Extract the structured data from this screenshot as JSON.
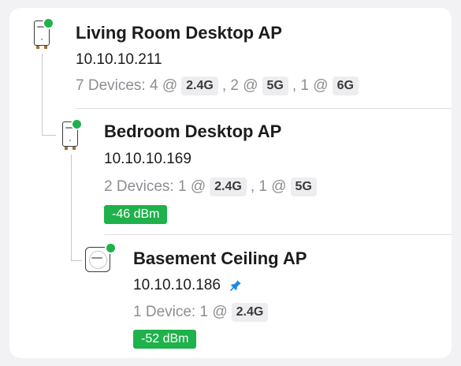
{
  "nodes": [
    {
      "title": "Living Room Desktop AP",
      "ip": "10.10.10.211",
      "devices_prefix": "7 Devices: 4 @",
      "bands": [
        {
          "label": "2.4G",
          "after": ", 2 @"
        },
        {
          "label": "5G",
          "after": ", 1 @"
        },
        {
          "label": "6G",
          "after": ""
        }
      ],
      "icon": "desktop-ap-icon",
      "status_color": "#1fb14b"
    },
    {
      "title": "Bedroom Desktop AP",
      "ip": "10.10.10.169",
      "devices_prefix": "2 Devices: 1 @",
      "bands": [
        {
          "label": "2.4G",
          "after": ", 1 @"
        },
        {
          "label": "5G",
          "after": ""
        }
      ],
      "signal": "-46 dBm",
      "icon": "desktop-ap-icon",
      "status_color": "#1fb14b"
    },
    {
      "title": "Basement Ceiling AP",
      "ip": "10.10.10.186",
      "pinned": true,
      "devices_prefix": "1 Device: 1 @",
      "bands": [
        {
          "label": "2.4G",
          "after": ""
        }
      ],
      "signal": "-52 dBm",
      "icon": "ceiling-ap-icon",
      "status_color": "#1fb14b"
    }
  ],
  "colors": {
    "signal_good": "#1fb14b",
    "pin": "#1e88e5"
  }
}
